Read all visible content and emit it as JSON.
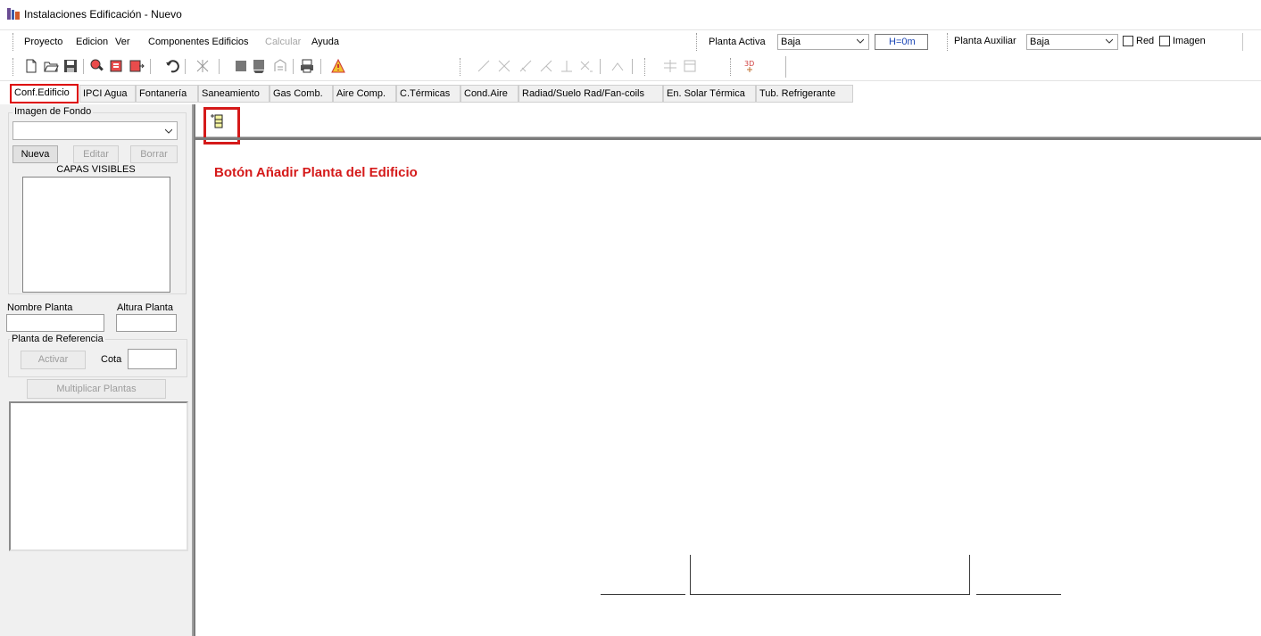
{
  "window": {
    "title": "Instalaciones Edificación - Nuevo"
  },
  "menu": {
    "items": [
      {
        "label": "Proyecto",
        "enabled": true
      },
      {
        "label": "Edicion",
        "enabled": true
      },
      {
        "label": "Ver",
        "enabled": true
      },
      {
        "label": "Componentes Edificios",
        "enabled": true
      },
      {
        "label": "Calcular",
        "enabled": false
      },
      {
        "label": "Ayuda",
        "enabled": true
      }
    ],
    "planta_activa_label": "Planta Activa",
    "planta_activa_value": "Baja",
    "height_value": "H=0m",
    "planta_auxiliar_label": "Planta Auxiliar",
    "planta_auxiliar_value": "Baja",
    "red_label": "Red",
    "imagen_label": "Imagen"
  },
  "tabs": [
    "Conf.Edificio",
    "IPCI Agua",
    "Fontanería",
    "Saneamiento",
    "Gas Comb.",
    "Aire Comp.",
    "C.Térmicas",
    "Cond.Aire",
    "Radiad/Suelo Rad/Fan-coils",
    "En. Solar Térmica",
    "Tub. Refrigerante"
  ],
  "left_panel": {
    "imagen_fondo_label": "Imagen de Fondo",
    "nueva_button": "Nueva",
    "editar_button": "Editar",
    "borrar_button": "Borrar",
    "capas_visibles_label": "CAPAS VISIBLES",
    "nombre_planta_label": "Nombre Planta",
    "altura_planta_label": "Altura Planta",
    "planta_referencia_label": "Planta de Referencia",
    "activar_button": "Activar",
    "cota_label": "Cota",
    "multiplicar_button": "Multiplicar Plantas"
  },
  "canvas": {
    "annotation_text": "Botón Añadir Planta del Edificio"
  },
  "colors": {
    "highlight_red": "#d51a1a",
    "panel_gray": "#f0f0f0"
  }
}
